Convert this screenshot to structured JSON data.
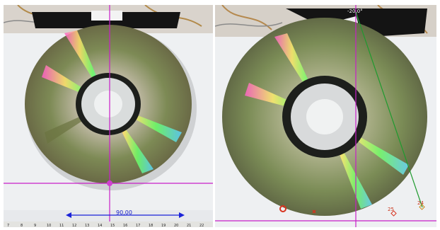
{
  "left_view": {
    "measure_label": "90,00",
    "ruler_numbers": [
      "7",
      "8",
      "9",
      "10",
      "11",
      "12",
      "13",
      "14",
      "15",
      "16",
      "17",
      "18",
      "19",
      "20",
      "21",
      "22"
    ]
  },
  "right_view": {
    "angle_readout": "-20,0°",
    "frame_labels": [
      "24",
      "25"
    ]
  },
  "colors": {
    "crosshair": "#c81ec8",
    "measure_arrow": "#1a22d8",
    "trajectory": "#1e9a2e",
    "marker": "#d8321e"
  },
  "icons": [
    "disc-image",
    "crosshair",
    "ruler",
    "point-marker"
  ]
}
